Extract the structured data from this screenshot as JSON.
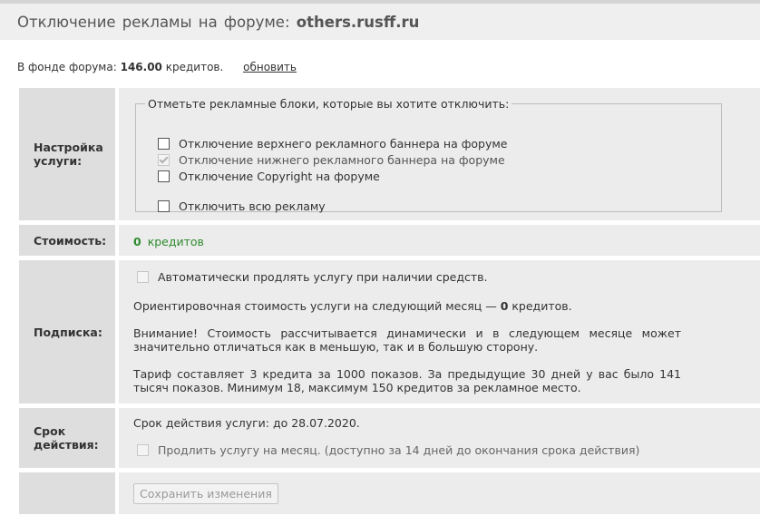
{
  "page": {
    "title_prefix": "Отключение рекламы на форуме:",
    "forum_domain": "others.rusff.ru"
  },
  "fund": {
    "prefix": "В фонде форума:",
    "amount": "146.00",
    "unit": "кредитов.",
    "refresh_link": "обновить"
  },
  "settings": {
    "label": "Настройка услуги:",
    "legend": "Отметьте рекламные блоки, которые вы хотите отключить:",
    "options": [
      {
        "label": "Отключение верхнего рекламного баннера на форуме",
        "checked": false,
        "disabled": false
      },
      {
        "label": "Отключение нижнего рекламного баннера на форуме",
        "checked": true,
        "disabled": true
      },
      {
        "label": "Отключение Copyright на форуме",
        "checked": false,
        "disabled": false
      },
      {
        "label": "Отключить всю рекламу",
        "checked": false,
        "disabled": false
      }
    ]
  },
  "cost": {
    "label": "Стоимость:",
    "amount": "0",
    "unit": "кредитов"
  },
  "subscription": {
    "label": "Подписка:",
    "auto_renew": "Автоматически продлять услугу при наличии средств.",
    "estimate_prefix": "Ориентировочная стоимость услуги на следующий месяц —",
    "estimate_amount": "0",
    "estimate_unit": "кредитов.",
    "warning": "Внимание! Стоимость рассчитывается динамически и в следующем месяце может значительно отличаться как в меньшую, так и в большую сторону.",
    "tariff": "Тариф составляет 3 кредита за 1000 показов. За предыдущие 30 дней у вас было 141 тысяч показов. Минимум 18, максимум 150 кредитов за рекламное место."
  },
  "validity": {
    "label": "Срок действия:",
    "text": "Срок действия услуги: до 28.07.2020.",
    "extend": "Продлить услугу на месяц. (доступно за 14 дней до окончания срока действия)"
  },
  "actions": {
    "save": "Сохранить изменения"
  }
}
